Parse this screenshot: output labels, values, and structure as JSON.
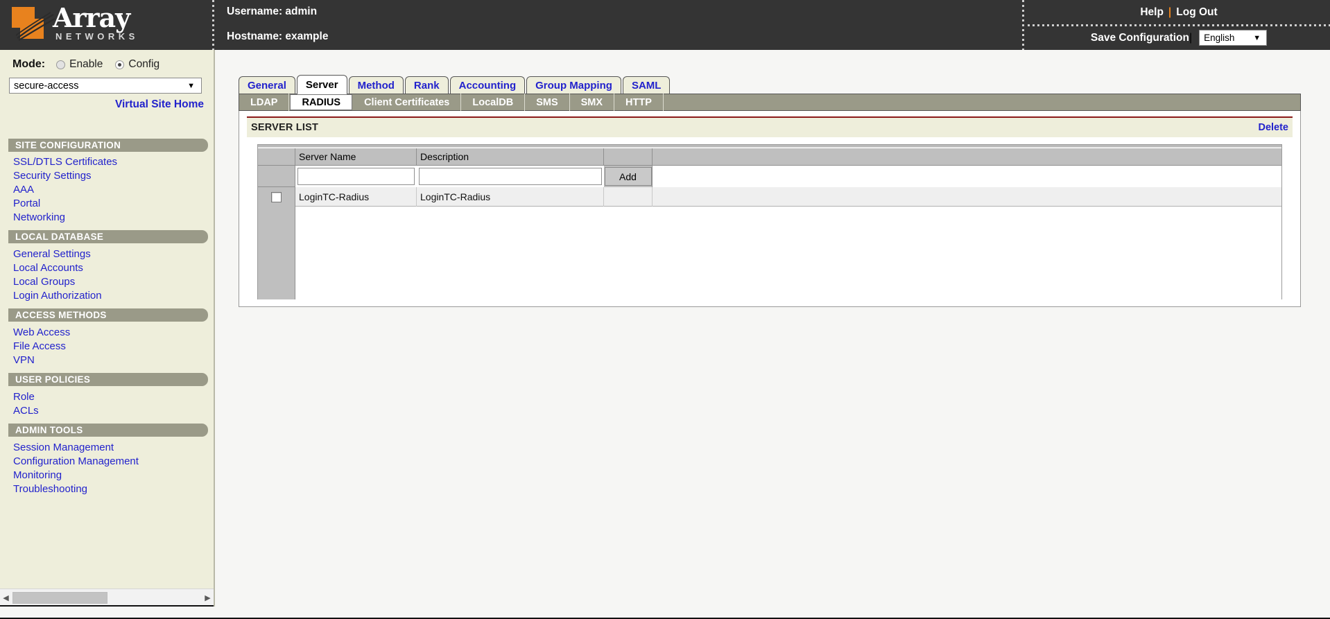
{
  "header": {
    "logo_text": "Array",
    "logo_subtext": "NETWORKS",
    "username_line": "Username: admin",
    "hostname_line": "Hostname: example",
    "help_label": "Help",
    "separator": "|",
    "logout_label": "Log Out",
    "save_config_label": "Save Configuration",
    "save_separator": "|",
    "language_value": "English",
    "caret_glyph": "▼"
  },
  "sidebar": {
    "mode_label": "Mode:",
    "mode_options": [
      {
        "label": "Enable",
        "selected": false
      },
      {
        "label": "Config",
        "selected": true
      }
    ],
    "site_select_value": "secure-access",
    "virtual_site_home_label": "Virtual Site Home",
    "sections": [
      {
        "title": "SITE CONFIGURATION",
        "items": [
          "SSL/DTLS Certificates",
          "Security Settings",
          "AAA",
          "Portal",
          "Networking"
        ]
      },
      {
        "title": "LOCAL DATABASE",
        "items": [
          "General Settings",
          "Local Accounts",
          "Local Groups",
          "Login Authorization"
        ]
      },
      {
        "title": "ACCESS METHODS",
        "items": [
          "Web Access",
          "File Access",
          "VPN"
        ]
      },
      {
        "title": "USER POLICIES",
        "items": [
          "Role",
          "ACLs"
        ]
      },
      {
        "title": "ADMIN TOOLS",
        "items": [
          "Session Management",
          "Configuration Management",
          "Monitoring",
          "Troubleshooting"
        ]
      }
    ],
    "scroll_left_glyph": "◀",
    "scroll_right_glyph": "▶"
  },
  "main": {
    "tabs": [
      {
        "label": "General",
        "active": false
      },
      {
        "label": "Server",
        "active": true
      },
      {
        "label": "Method",
        "active": false
      },
      {
        "label": "Rank",
        "active": false
      },
      {
        "label": "Accounting",
        "active": false
      },
      {
        "label": "Group Mapping",
        "active": false
      },
      {
        "label": "SAML",
        "active": false
      }
    ],
    "subtabs": [
      {
        "label": "LDAP",
        "active": false
      },
      {
        "label": "RADIUS",
        "active": true
      },
      {
        "label": "Client Certificates",
        "active": false
      },
      {
        "label": "LocalDB",
        "active": false
      },
      {
        "label": "SMS",
        "active": false
      },
      {
        "label": "SMX",
        "active": false
      },
      {
        "label": "HTTP",
        "active": false
      }
    ],
    "panel": {
      "title": "SERVER LIST",
      "delete_label": "Delete",
      "columns": [
        "",
        "Server Name",
        "Description",
        "",
        ""
      ],
      "new_row": {
        "server_name_value": "",
        "server_name_placeholder": "",
        "description_value": "",
        "description_placeholder": "",
        "add_label": "Add"
      },
      "rows": [
        {
          "checked": false,
          "server_name": "LoginTC-Radius",
          "description": "LoginTC-Radius",
          "action": "",
          "extra": ""
        }
      ]
    }
  },
  "colors": {
    "header_bg": "#343434",
    "sidebar_bg": "#eeeedb",
    "section_bar": "#9a9a88",
    "link_blue": "#2222cc",
    "accent_orange": "#e8821e",
    "rule_red": "#8b1a1a",
    "grid_header": "#bfbfbf"
  }
}
